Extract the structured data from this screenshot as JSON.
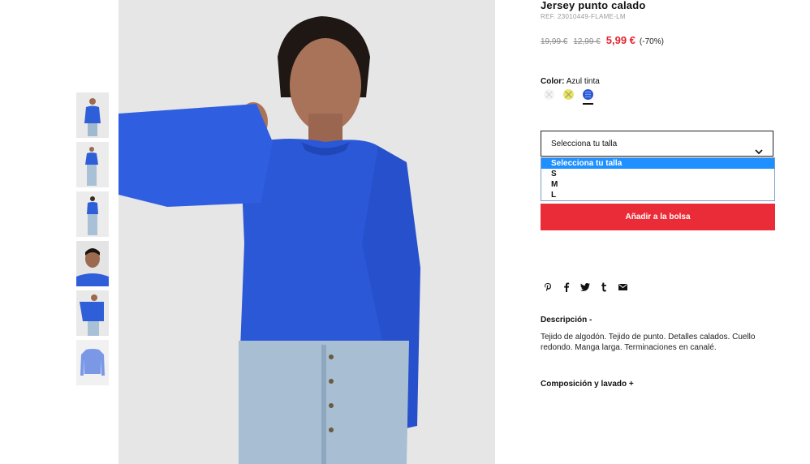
{
  "product": {
    "title": "Jersey punto calado",
    "ref": "REF. 23010449-FLAME-LM"
  },
  "prices": {
    "original": "19,99 €",
    "previous": "12,99 €",
    "current": "5,99 €",
    "discount": "(-70%)"
  },
  "color": {
    "label": "Color:",
    "value": "Azul tinta",
    "swatches": [
      {
        "name": "white",
        "hex": "#f2f2f2"
      },
      {
        "name": "yellow",
        "hex": "#e8e36a"
      },
      {
        "name": "blue",
        "hex": "#2a56d4",
        "selected": true
      }
    ]
  },
  "size": {
    "placeholder": "Selecciona tu talla",
    "options": [
      "Selecciona tu talla",
      "S",
      "M",
      "L"
    ]
  },
  "add_to_bag": "Añadir a la bolsa",
  "share_icons": [
    "pinterest-icon",
    "facebook-icon",
    "twitter-icon",
    "tumblr-icon",
    "email-icon"
  ],
  "description": {
    "title": "Descripción -",
    "text": "Tejido de algodón. Tejido de punto. Detalles calados. Cuello redondo. Manga larga. Terminaciones en canalé."
  },
  "composition": {
    "title": "Composición y lavado +"
  },
  "colors": {
    "accent_red": "#e92c37",
    "price_red": "#e4242f",
    "dropdown_highlight": "#1e90ff",
    "sweater_blue": "#2a56d4"
  }
}
